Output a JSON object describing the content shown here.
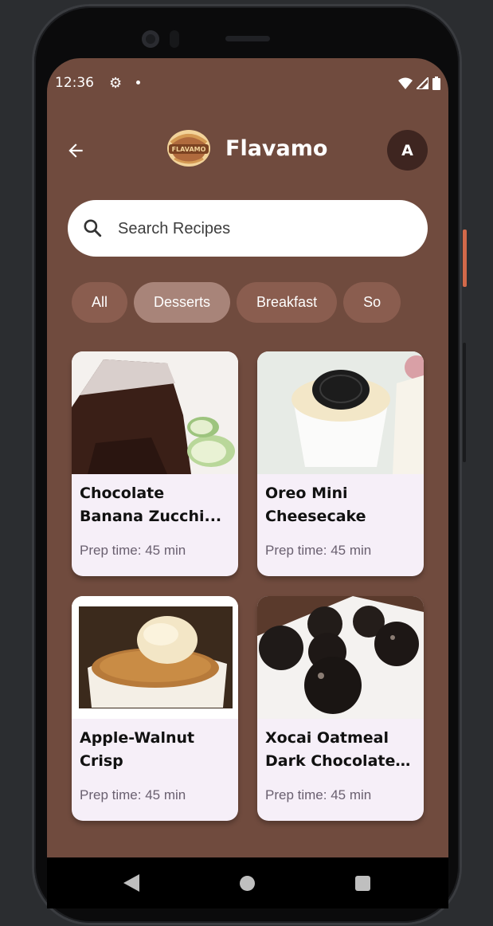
{
  "status_bar": {
    "time": "12:36"
  },
  "app_bar": {
    "title": "Flavamo",
    "avatar_letter": "A",
    "logo_text": "FLAVAMO"
  },
  "search": {
    "placeholder": "Search Recipes",
    "value": ""
  },
  "categories": {
    "selected": "Desserts",
    "items": [
      "All",
      "Desserts",
      "Breakfast",
      "So"
    ]
  },
  "recipes": [
    {
      "name": "Chocolate Banana Zucchi...",
      "prep": "Prep time: 45 min"
    },
    {
      "name": "Oreo Mini Cheesecake",
      "prep": "Prep time: 45 min"
    },
    {
      "name": "Apple-Walnut Crisp",
      "prep": "Prep time: 45 min"
    },
    {
      "name": "Xocai Oatmeal Dark Chocolate ...",
      "prep": "Prep time: 45 min"
    }
  ],
  "colors": {
    "background": "#704b3e",
    "chip": "#8a5d4f",
    "chip_selected": "#a88479",
    "card": "#f6eff8",
    "avatar": "#3e2520"
  }
}
